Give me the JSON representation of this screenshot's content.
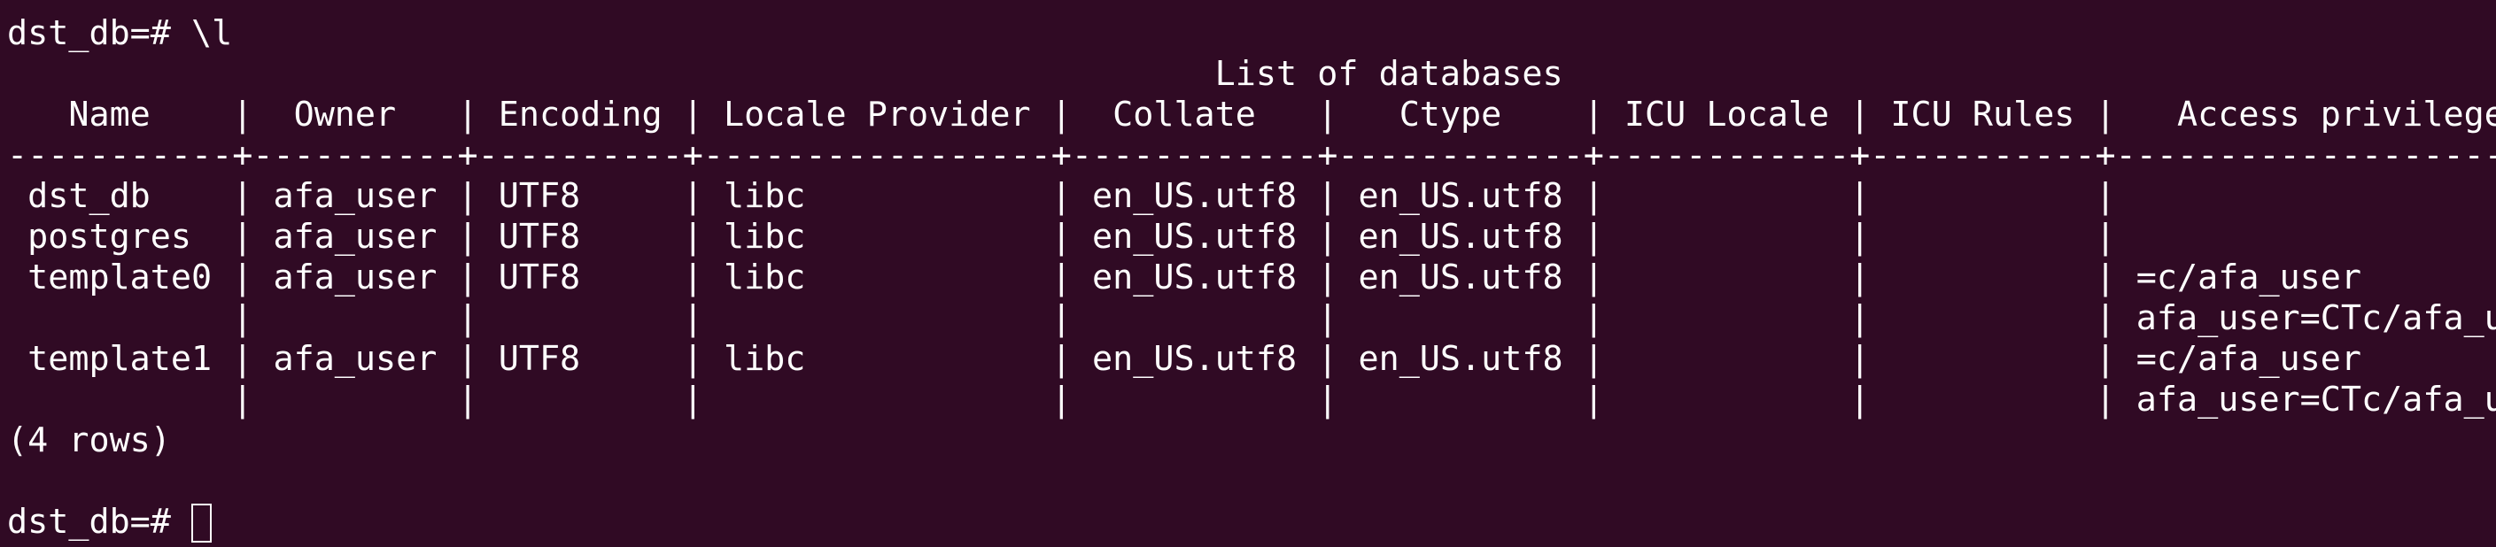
{
  "terminal": {
    "background": "#300a24",
    "foreground": "#ffffff",
    "lines": [
      "dst_db=# \\l",
      "                                                           List of databases",
      "   Name    |  Owner   | Encoding | Locale Provider |  Collate   |   Ctype    | ICU Locale | ICU Rules |   Access privileges   ",
      "-----------+----------+----------+-----------------+------------+------------+------------+-----------+-----------------------",
      " dst_db    | afa_user | UTF8     | libc            | en_US.utf8 | en_US.utf8 |            |           | ",
      " postgres  | afa_user | UTF8     | libc            | en_US.utf8 | en_US.utf8 |            |           | ",
      " template0 | afa_user | UTF8     | libc            | en_US.utf8 | en_US.utf8 |            |           | =c/afa_user          +",
      "           |          |          |                 |            |            |            |           | afa_user=CTc/afa_user",
      " template1 | afa_user | UTF8     | libc            | en_US.utf8 | en_US.utf8 |            |           | =c/afa_user          +",
      "           |          |          |                 |            |            |            |           | afa_user=CTc/afa_user",
      "(4 rows)",
      ""
    ],
    "prompt": "dst_db=# "
  }
}
